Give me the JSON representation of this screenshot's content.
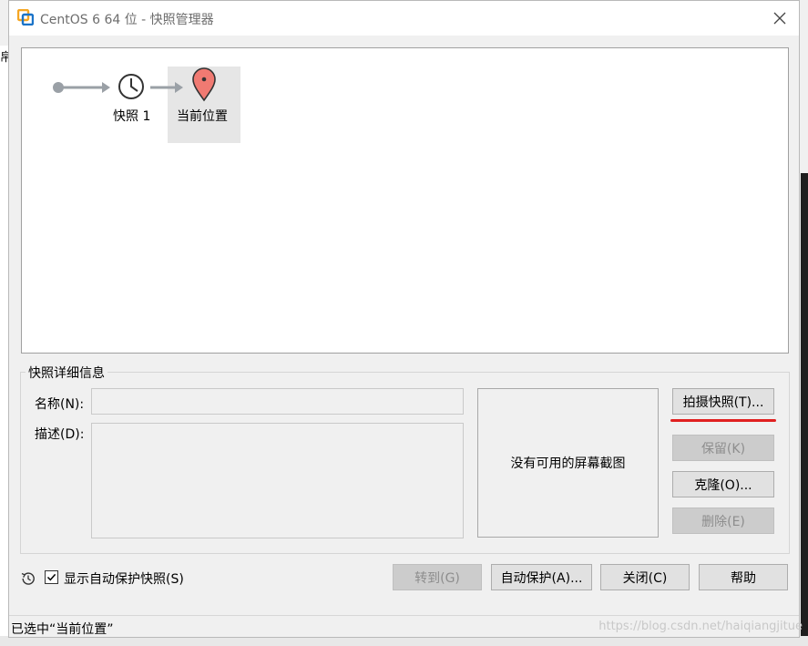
{
  "background": {
    "left_edge_text": "帛"
  },
  "window": {
    "title": "CentOS 6 64 位 - 快照管理器",
    "close_icon": "close-icon"
  },
  "tree": {
    "snapshot_label": "快照 1",
    "current_label": "当前位置"
  },
  "details": {
    "group_title": "快照详细信息",
    "name_label": "名称(N):",
    "name_value": "",
    "desc_label": "描述(D):",
    "desc_value": "",
    "screenshot_text": "没有可用的屏幕截图"
  },
  "side_buttons": {
    "take_snapshot": "拍摄快照(T)...",
    "keep": "保留(K)",
    "clone": "克隆(O)...",
    "delete": "删除(E)"
  },
  "bottom": {
    "show_autoprotect_label": "显示自动保护快照(S)",
    "show_autoprotect_checked": true,
    "goto": "转到(G)",
    "autoprotect": "自动保护(A)...",
    "close": "关闭(C)",
    "help": "帮助"
  },
  "status": {
    "text": "已选中“当前位置”"
  },
  "watermark": "https://blog.csdn.net/haiqiangjitue",
  "colors": {
    "accent_red": "#e02020",
    "pin_red": "#f07a72",
    "icon_gray": "#9aa0a6"
  }
}
